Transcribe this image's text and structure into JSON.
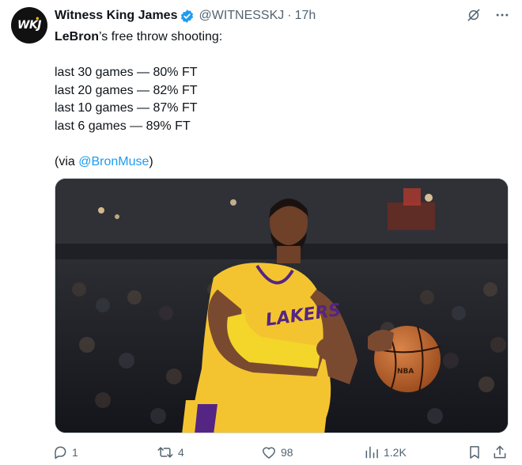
{
  "author": {
    "display_name": "Witness King James",
    "handle": "@WITNESSKJ",
    "separator": "·",
    "time": "17h",
    "avatar_text": "WKJ",
    "avatar_mark": "•"
  },
  "icons": {
    "verified": "verified-badge-icon",
    "grok": "grok-icon",
    "more": "more-icon",
    "reply": "reply-icon",
    "retweet": "retweet-icon",
    "like": "like-icon",
    "views": "views-icon",
    "bookmark": "bookmark-icon",
    "share": "share-icon"
  },
  "tweet": {
    "intro_bold": "LeBron",
    "intro_rest": "’s free throw shooting:",
    "stats": [
      "last 30 games — 80% FT",
      "last 20 games — 82% FT",
      "last 10 games — 87% FT",
      "last 6 games — 89% FT"
    ],
    "via_prefix": "(via ",
    "via_link": "@BronMuse",
    "via_suffix": ")"
  },
  "media": {
    "jersey_text": "LAKERS",
    "ball_text": "NBA"
  },
  "actions": {
    "replies": "1",
    "retweets": "4",
    "likes": "98",
    "views": "1.2K"
  },
  "colors": {
    "link": "#1d9bf0",
    "verified": "#1d9bf0",
    "lakers_gold": "#f4c430",
    "lakers_purple": "#552583",
    "secondary_text": "#536471"
  }
}
